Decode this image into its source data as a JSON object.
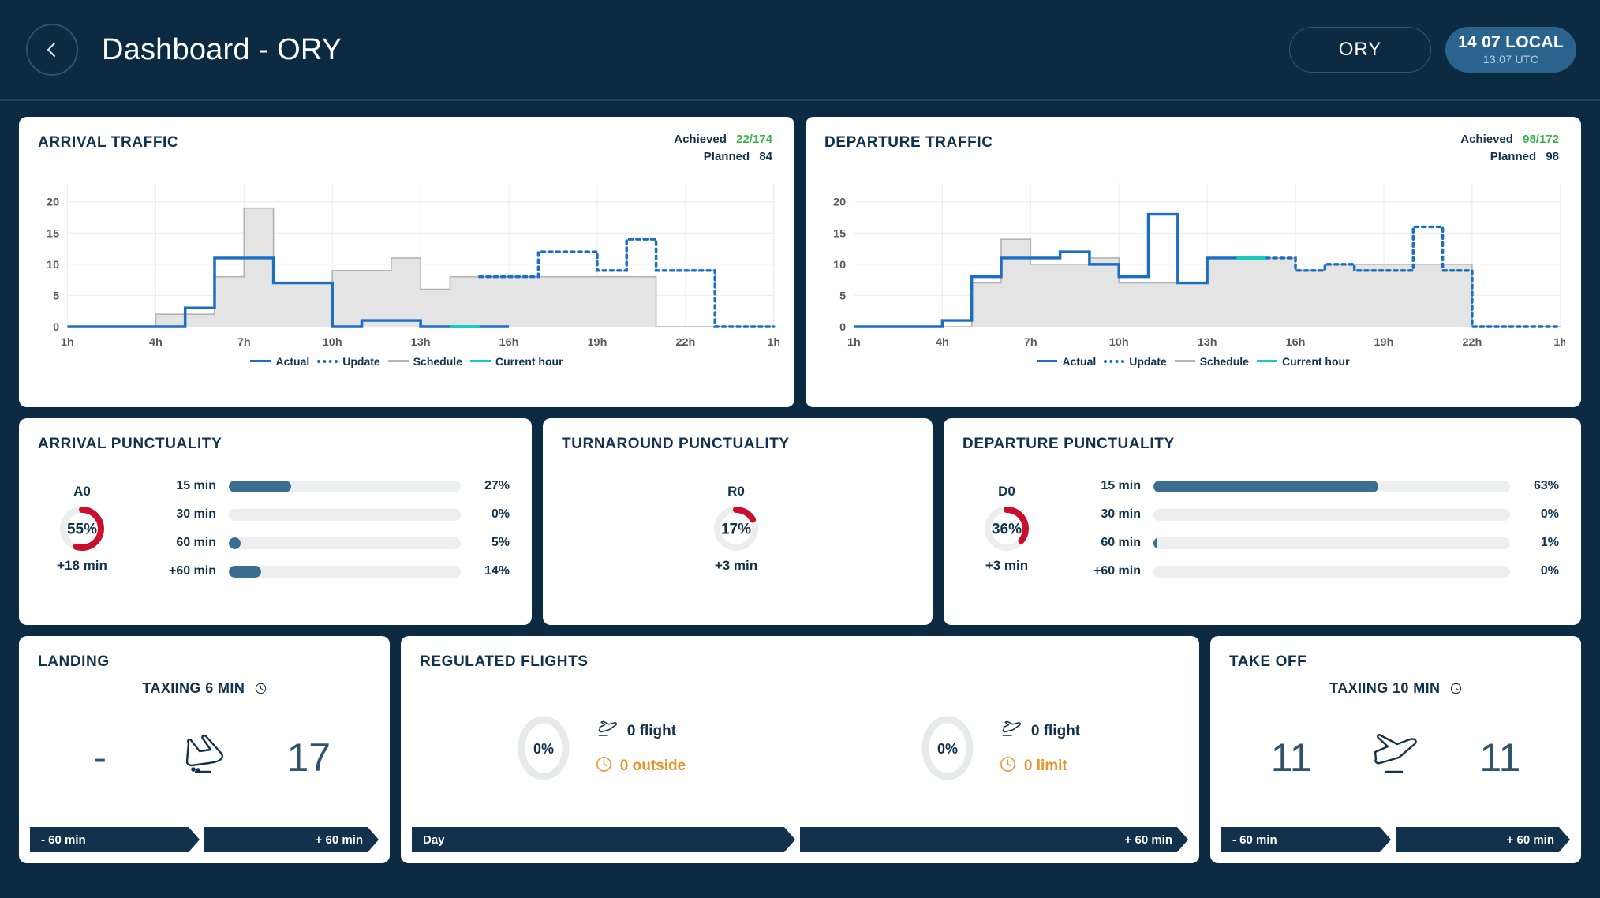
{
  "header": {
    "back_icon": "chevron-left-icon",
    "title": "Dashboard  - ORY",
    "airport": "ORY",
    "time_local": "14 07 LOCAL",
    "time_utc": "13:07 UTC"
  },
  "colors": {
    "background": "#0c2b42",
    "card": "#ffffff",
    "text_dark": "#12314c",
    "actual": "#1b6ec2",
    "update": "#1b6ec2",
    "schedule": "#b4b4b4",
    "current_hour": "#18ccc4",
    "gauge_red": "#c8102e",
    "bar_fill": "#3a6e91",
    "achieved_green": "#3ab54a",
    "amber": "#e8922a",
    "accent_pill": "#2a648e"
  },
  "legend": [
    {
      "label": "Actual",
      "style": "solid",
      "color": "#1b6ec2"
    },
    {
      "label": "Update",
      "style": "dotted",
      "color": "#1b6ec2"
    },
    {
      "label": "Schedule",
      "style": "solid",
      "color": "#b4b4b4"
    },
    {
      "label": "Current hour",
      "style": "solid",
      "color": "#18ccc4"
    }
  ],
  "arrival_traffic": {
    "title": "ARRIVAL TRAFFIC",
    "achieved_label": "Achieved",
    "achieved_value": "22/174",
    "planned_label": "Planned",
    "planned_value": "84"
  },
  "departure_traffic": {
    "title": "DEPARTURE TRAFFIC",
    "achieved_label": "Achieved",
    "achieved_value": "98/172",
    "planned_label": "Planned",
    "planned_value": "98"
  },
  "arrival_punctuality": {
    "title": "ARRIVAL PUNCTUALITY",
    "gauge": {
      "code": "A0",
      "percent": 55,
      "percent_label": "55%",
      "delay_label": "+18 min"
    },
    "bars": [
      {
        "label": "15 min",
        "percent": 27,
        "percent_label": "27%"
      },
      {
        "label": "30 min",
        "percent": 0,
        "percent_label": "0%"
      },
      {
        "label": "60 min",
        "percent": 5,
        "percent_label": "5%"
      },
      {
        "label": "+60 min",
        "percent": 14,
        "percent_label": "14%"
      }
    ]
  },
  "turnaround_punctuality": {
    "title": "TURNAROUND PUNCTUALITY",
    "gauge": {
      "code": "R0",
      "percent": 17,
      "percent_label": "17%",
      "delay_label": "+3 min"
    }
  },
  "departure_punctuality": {
    "title": "DEPARTURE PUNCTUALITY",
    "gauge": {
      "code": "D0",
      "percent": 36,
      "percent_label": "36%",
      "delay_label": "+3 min"
    },
    "bars": [
      {
        "label": "15 min",
        "percent": 63,
        "percent_label": "63%"
      },
      {
        "label": "30 min",
        "percent": 0,
        "percent_label": "0%"
      },
      {
        "label": "60 min",
        "percent": 1,
        "percent_label": "1%"
      },
      {
        "label": "+60 min",
        "percent": 0,
        "percent_label": "0%"
      }
    ]
  },
  "landing": {
    "title": "LANDING",
    "taxiing_label": "TAXIING 6 MIN",
    "clock_icon": "clock-icon",
    "plane_icon": "plane-landing-icon",
    "left_value": "-",
    "right_value": "17",
    "footer_left": "- 60 min",
    "footer_right": "+ 60 min"
  },
  "regulated_flights": {
    "title": "REGULATED FLIGHTS",
    "halves": [
      {
        "donut_percent": 0,
        "donut_label": "0%",
        "flight_icon": "plane-takeoff-icon",
        "flight_value": "0 flight",
        "alert_icon": "clock-icon",
        "alert_value": "0 outside"
      },
      {
        "donut_percent": 0,
        "donut_label": "0%",
        "flight_icon": "plane-takeoff-icon",
        "flight_value": "0 flight",
        "alert_icon": "clock-icon",
        "alert_value": "0 limit"
      }
    ],
    "footer_left": "Day",
    "footer_right": "+ 60 min"
  },
  "take_off": {
    "title": "TAKE OFF",
    "taxiing_label": "TAXIING 10 MIN",
    "clock_icon": "clock-icon",
    "plane_icon": "plane-takeoff-icon",
    "left_value": "11",
    "right_value": "11",
    "footer_left": "- 60 min",
    "footer_right": "+ 60 min"
  },
  "chart_data": [
    {
      "type": "area",
      "name": "arrival_traffic",
      "title": "ARRIVAL TRAFFIC",
      "xlabel": "",
      "ylabel": "",
      "ylim": [
        0,
        23
      ],
      "yticks": [
        0,
        5,
        10,
        15,
        20
      ],
      "xticks": [
        "1h",
        "4h",
        "7h",
        "10h",
        "13h",
        "16h",
        "19h",
        "22h",
        "1h"
      ],
      "x": [
        "1h",
        "2h",
        "3h",
        "4h",
        "5h",
        "6h",
        "7h",
        "8h",
        "9h",
        "10h",
        "11h",
        "12h",
        "13h",
        "14h",
        "15h",
        "16h",
        "17h",
        "18h",
        "19h",
        "20h",
        "21h",
        "22h",
        "23h",
        "0h"
      ],
      "grid": true,
      "legend_position": "bottom",
      "current_hour_index": 13,
      "series": [
        {
          "name": "Schedule",
          "style": "step-area",
          "color": "#b4b4b4",
          "values": [
            0,
            0,
            0,
            2,
            2,
            8,
            19,
            7,
            7,
            9,
            9,
            11,
            6,
            8,
            8,
            8,
            8,
            8,
            8,
            8,
            0,
            0,
            0,
            0
          ]
        },
        {
          "name": "Actual",
          "style": "step-line",
          "color": "#1b6ec2",
          "values": [
            0,
            0,
            0,
            0,
            3,
            11,
            11,
            7,
            7,
            0,
            1,
            1,
            0,
            0,
            0,
            null,
            null,
            null,
            null,
            null,
            null,
            null,
            null,
            null
          ]
        },
        {
          "name": "Update",
          "style": "step-line-dotted",
          "color": "#1b6ec2",
          "values": [
            null,
            null,
            null,
            null,
            null,
            null,
            null,
            null,
            null,
            null,
            null,
            null,
            null,
            null,
            8,
            8,
            12,
            12,
            9,
            14,
            9,
            9,
            0,
            0
          ]
        },
        {
          "name": "Current hour",
          "style": "marker",
          "color": "#18ccc4",
          "values": [
            null,
            null,
            null,
            null,
            null,
            null,
            null,
            null,
            null,
            null,
            null,
            null,
            null,
            null,
            8,
            null,
            null,
            null,
            null,
            null,
            null,
            null,
            null,
            null
          ]
        }
      ]
    },
    {
      "type": "area",
      "name": "departure_traffic",
      "title": "DEPARTURE TRAFFIC",
      "xlabel": "",
      "ylabel": "",
      "ylim": [
        0,
        23
      ],
      "yticks": [
        0,
        5,
        10,
        15,
        20
      ],
      "xticks": [
        "1h",
        "4h",
        "7h",
        "10h",
        "13h",
        "16h",
        "19h",
        "22h",
        "1h"
      ],
      "x": [
        "1h",
        "2h",
        "3h",
        "4h",
        "5h",
        "6h",
        "7h",
        "8h",
        "9h",
        "10h",
        "11h",
        "12h",
        "13h",
        "14h",
        "15h",
        "16h",
        "17h",
        "18h",
        "19h",
        "20h",
        "21h",
        "22h",
        "23h",
        "0h"
      ],
      "grid": true,
      "legend_position": "bottom",
      "current_hour_index": 13,
      "series": [
        {
          "name": "Schedule",
          "style": "step-area",
          "color": "#b4b4b4",
          "values": [
            0,
            0,
            0,
            0,
            7,
            14,
            10,
            10,
            11,
            7,
            7,
            7,
            11,
            11,
            11,
            9,
            10,
            10,
            10,
            10,
            10,
            0,
            0,
            0
          ]
        },
        {
          "name": "Actual",
          "style": "step-line",
          "color": "#1b6ec2",
          "values": [
            0,
            0,
            0,
            1,
            8,
            11,
            11,
            12,
            10,
            8,
            18,
            7,
            11,
            11,
            null,
            null,
            null,
            null,
            null,
            null,
            null,
            null,
            null,
            null
          ]
        },
        {
          "name": "Update",
          "style": "step-line-dotted",
          "color": "#1b6ec2",
          "values": [
            null,
            null,
            null,
            null,
            null,
            null,
            null,
            null,
            null,
            null,
            null,
            null,
            null,
            null,
            11,
            9,
            10,
            9,
            9,
            16,
            9,
            0,
            0,
            0
          ]
        },
        {
          "name": "Current hour",
          "style": "marker",
          "color": "#18ccc4",
          "values": [
            null,
            null,
            null,
            null,
            null,
            null,
            null,
            null,
            null,
            null,
            null,
            null,
            null,
            11,
            null,
            null,
            null,
            null,
            null,
            null,
            null,
            null,
            null,
            null
          ]
        }
      ]
    }
  ]
}
